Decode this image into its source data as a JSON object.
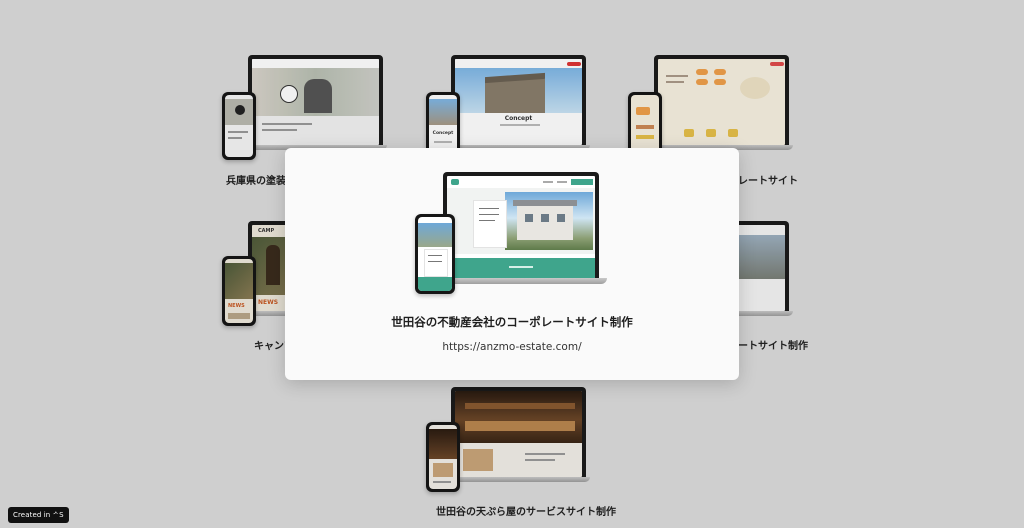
{
  "portfolio": {
    "items": [
      {
        "caption": "兵庫県の塗装業"
      },
      {
        "caption": "レートサイト"
      },
      {
        "caption": "キャンプ"
      },
      {
        "caption": "ートサイト制作"
      },
      {
        "caption": "世田谷の天ぷら屋のサービスサイト制作"
      }
    ]
  },
  "screens": {
    "item2_heading": "Concept",
    "item2_phone_heading": "Concept",
    "item4_logo": "CAMP",
    "item4_news": "NEWS"
  },
  "modal": {
    "title": "世田谷の不動産会社のコーポレートサイト制作",
    "url": "https://anzmo-estate.com/"
  },
  "footer": {
    "badge_label": "Created in",
    "badge_logo": "ᄼS"
  },
  "colors": {
    "background": "#dcdcdc",
    "card": "#fafafa",
    "estate_accent": "#3fa58c"
  }
}
